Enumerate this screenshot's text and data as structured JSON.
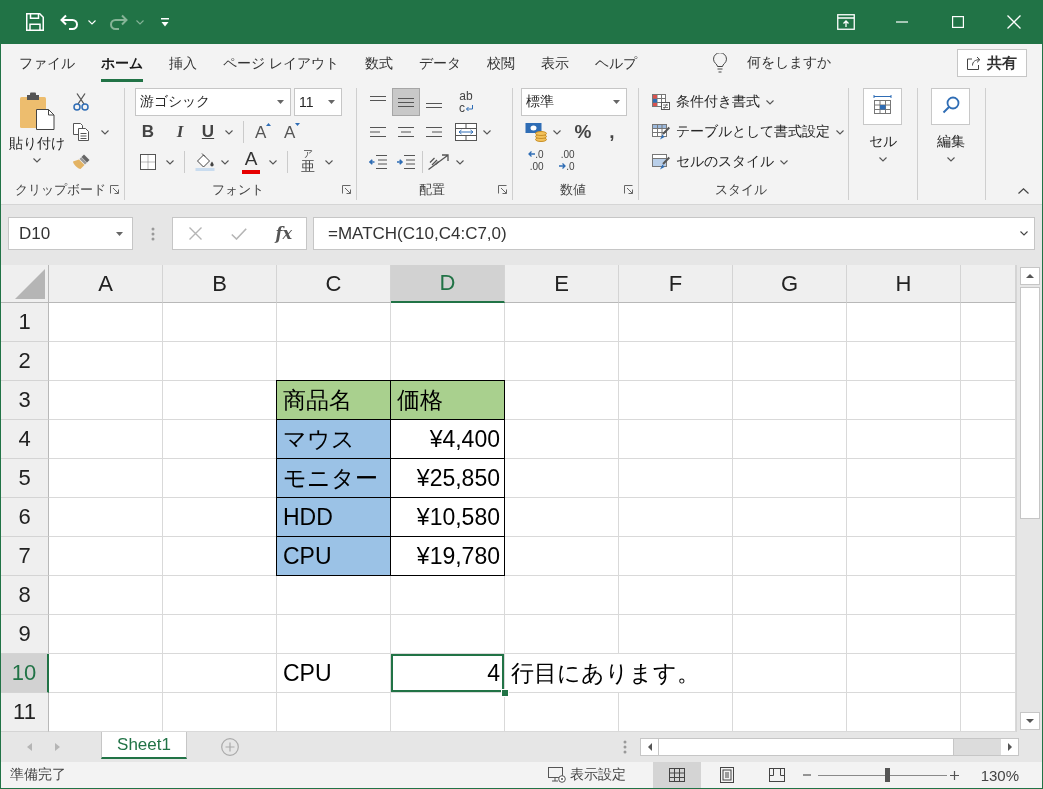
{
  "quick_access": [
    {
      "kind": "save",
      "disabled": false
    },
    {
      "kind": "undo",
      "disabled": false
    },
    {
      "kind": "redo",
      "disabled": true
    },
    {
      "kind": "customize",
      "disabled": false
    }
  ],
  "ribbon_tabs": [
    {
      "label": "ファイル",
      "selected": false
    },
    {
      "label": "ホーム",
      "selected": true
    },
    {
      "label": "挿入",
      "selected": false
    },
    {
      "label": "ページ レイアウト",
      "selected": false
    },
    {
      "label": "数式",
      "selected": false
    },
    {
      "label": "データ",
      "selected": false
    },
    {
      "label": "校閲",
      "selected": false
    },
    {
      "label": "表示",
      "selected": false
    },
    {
      "label": "ヘルプ",
      "selected": false
    }
  ],
  "tell_me": "何をしますか",
  "share_button": "共有",
  "ribbon": {
    "clipboard": {
      "label": "クリップボード",
      "paste": "貼り付け"
    },
    "font": {
      "label": "フォント",
      "font_name": "游ゴシック",
      "font_size": "11",
      "styles": [
        {
          "kind": "bold",
          "label": "B",
          "on": false
        },
        {
          "kind": "italic",
          "label": "I",
          "on": false
        },
        {
          "kind": "underline",
          "label": "U",
          "on": false
        }
      ],
      "grow": "A",
      "shrink": "A",
      "font_color": "A",
      "phonetic": {
        "ruby": "ア",
        "base": "亜"
      }
    },
    "alignment": {
      "label": "配置",
      "vertical": [
        {
          "kind": "top",
          "selected": false
        },
        {
          "kind": "middle",
          "selected": true
        },
        {
          "kind": "bottom",
          "selected": false
        }
      ],
      "wrap_text": [
        "ab",
        "c"
      ],
      "horizontal": [
        {
          "kind": "left",
          "selected": false
        },
        {
          "kind": "center",
          "selected": false
        },
        {
          "kind": "right",
          "selected": false
        }
      ]
    },
    "number": {
      "label": "数値",
      "format": "標準",
      "percent": "%",
      "comma": ",",
      "increase_decimal": [
        ".0",
        ".00"
      ],
      "decrease_decimal": [
        ".00",
        ".0"
      ]
    },
    "styles": {
      "label": "スタイル",
      "items": [
        {
          "kind": "conditional",
          "label": "条件付き書式"
        },
        {
          "kind": "table",
          "label": "テーブルとして書式設定"
        },
        {
          "kind": "cell",
          "label": "セルのスタイル"
        }
      ]
    },
    "cells": {
      "label": "セル"
    },
    "editing": {
      "label": "編集"
    }
  },
  "formula_bar": {
    "name_box": "D10",
    "cancel_disabled": true,
    "enter_disabled": true,
    "function_button": "fx",
    "formula": "=MATCH(C10,C4:C7,0)"
  },
  "sheet": {
    "columns": [
      {
        "label": "A",
        "selected": false
      },
      {
        "label": "B",
        "selected": false
      },
      {
        "label": "C",
        "selected": false
      },
      {
        "label": "D",
        "selected": true
      },
      {
        "label": "E",
        "selected": false
      },
      {
        "label": "F",
        "selected": false
      },
      {
        "label": "G",
        "selected": false
      },
      {
        "label": "H",
        "selected": false
      }
    ],
    "rows": [
      {
        "label": "1",
        "selected": false
      },
      {
        "label": "2",
        "selected": false
      },
      {
        "label": "3",
        "selected": false
      },
      {
        "label": "4",
        "selected": false
      },
      {
        "label": "5",
        "selected": false
      },
      {
        "label": "6",
        "selected": false
      },
      {
        "label": "7",
        "selected": false
      },
      {
        "label": "8",
        "selected": false
      },
      {
        "label": "9",
        "selected": false
      },
      {
        "label": "10",
        "selected": true
      },
      {
        "label": "11",
        "selected": false
      }
    ],
    "product_table": {
      "header": [
        "商品名",
        "価格"
      ],
      "items": [
        {
          "name": "マウス",
          "price": "¥4,400"
        },
        {
          "name": "モニター",
          "price": "¥25,850"
        },
        {
          "name": "HDD",
          "price": "¥10,580"
        },
        {
          "name": "CPU",
          "price": "¥19,780"
        }
      ]
    },
    "lookup": {
      "key": "CPU",
      "result": {
        "value": "4",
        "selected": true
      },
      "note": "行目にあります。"
    }
  },
  "sheet_tabs": [
    {
      "label": "Sheet1",
      "selected": true
    }
  ],
  "status_bar": {
    "text": "準備完了",
    "display_settings": "表示設定",
    "views": [
      {
        "kind": "normal",
        "selected": true
      },
      {
        "kind": "page_layout",
        "selected": false
      },
      {
        "kind": "page_break",
        "selected": false
      }
    ],
    "zoom": {
      "level": 0.54,
      "label": "130%"
    }
  }
}
